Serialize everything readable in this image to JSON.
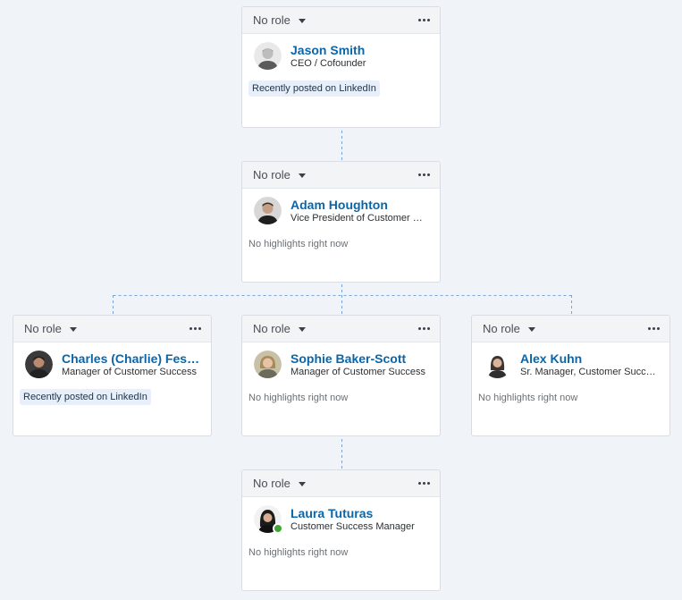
{
  "cards": [
    {
      "role": "No role",
      "name": "Jason Smith",
      "title": "CEO / Cofounder",
      "highlight": "Recently posted on LinkedIn",
      "avatar_icon": "person-avatar-icon",
      "online": false
    },
    {
      "role": "No role",
      "name": "Adam Houghton",
      "title": "Vice President of Customer Success",
      "highlight": "No highlights right now",
      "avatar_icon": "person-avatar-icon",
      "online": false
    },
    {
      "role": "No role",
      "name": "Charles (Charlie) Fessenden",
      "title": "Manager of Customer Success",
      "highlight": "Recently posted on LinkedIn",
      "avatar_icon": "person-avatar-icon",
      "online": false
    },
    {
      "role": "No role",
      "name": "Sophie Baker-Scott",
      "title": "Manager of Customer Success",
      "highlight": "No highlights right now",
      "avatar_icon": "person-avatar-icon",
      "online": false
    },
    {
      "role": "No role",
      "name": "Alex Kuhn",
      "title": "Sr. Manager, Customer Success",
      "highlight": "No highlights right now",
      "avatar_icon": "person-avatar-icon",
      "online": false
    },
    {
      "role": "No role",
      "name": "Laura Tuturas",
      "title": "Customer Success Manager",
      "highlight": "No highlights right now",
      "avatar_icon": "person-avatar-icon",
      "online": true
    }
  ],
  "colors": {
    "background": "#f0f3f7",
    "name_link": "#0a66a8",
    "connector": "#7ba3d4",
    "badge_bg": "#e6effa",
    "online": "#3fa534"
  }
}
